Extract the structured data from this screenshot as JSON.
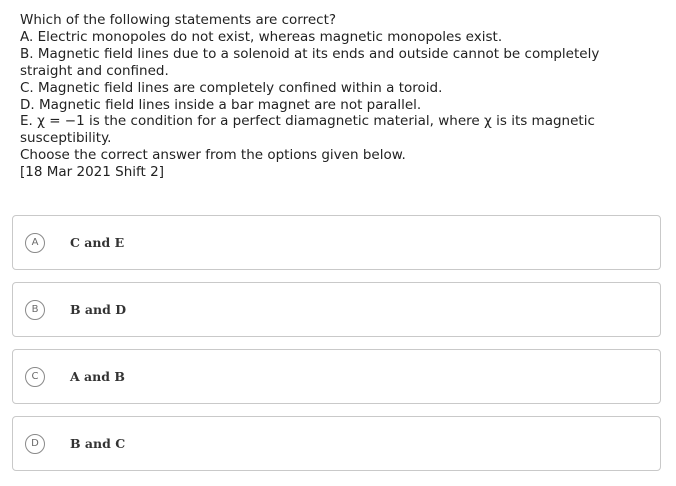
{
  "question": {
    "lines": [
      "Which of the following statements are correct?",
      "A. Electric monopoles do not exist, whereas magnetic monopoles exist.",
      "B. Magnetic field lines due to a solenoid at its ends and outside cannot be completely",
      "straight and confined.",
      "C. Magnetic field lines are completely confined within a toroid.",
      "D. Magnetic field lines inside a bar magnet are not parallel.",
      "E. χ = −1 is the condition for a perfect diamagnetic material, where χ is its magnetic",
      "susceptibility.",
      "Choose the correct answer from the options given below.",
      "[18 Mar 2021 Shift 2]"
    ]
  },
  "options": [
    {
      "letter": "A",
      "text": "C and E"
    },
    {
      "letter": "B",
      "text": "B and D"
    },
    {
      "letter": "C",
      "text": "A and B"
    },
    {
      "letter": "D",
      "text": "B and C"
    }
  ]
}
